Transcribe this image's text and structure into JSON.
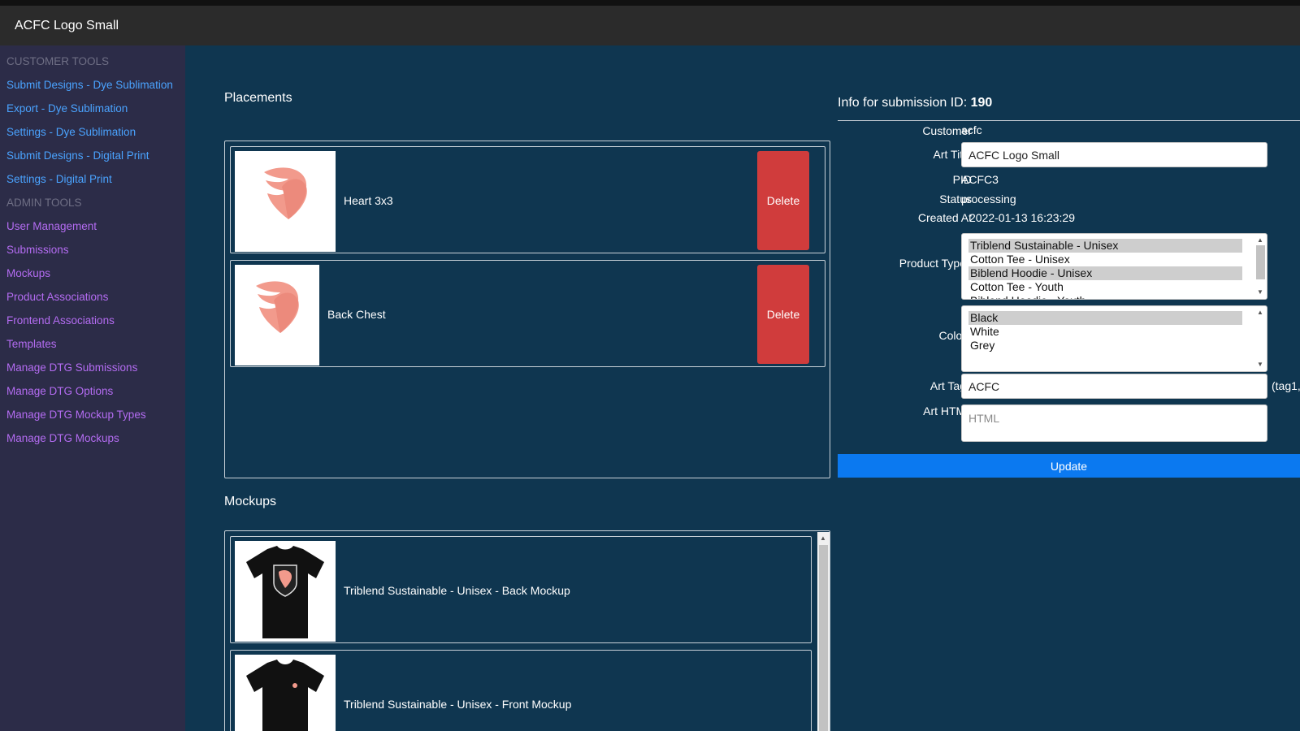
{
  "header": {
    "title": "ACFC Logo Small"
  },
  "colors": {
    "link": "#4aa3ff",
    "admin_link": "#b46cf2",
    "delete": "#d03c3c",
    "primary": "#0b79f0",
    "background": "#0f3650"
  },
  "sidebar": {
    "customer_heading": "CUSTOMER TOOLS",
    "customer_items": [
      {
        "label": "Submit Designs - Dye Sublimation"
      },
      {
        "label": "Export - Dye Sublimation"
      },
      {
        "label": "Settings - Dye Sublimation"
      },
      {
        "label": "Submit Designs - Digital Print"
      },
      {
        "label": "Settings - Digital Print"
      }
    ],
    "admin_heading": "ADMIN TOOLS",
    "admin_items": [
      {
        "label": "User Management"
      },
      {
        "label": "Submissions"
      },
      {
        "label": "Mockups"
      },
      {
        "label": "Product Associations"
      },
      {
        "label": "Frontend Associations"
      },
      {
        "label": "Templates"
      },
      {
        "label": "Manage DTG Submissions"
      },
      {
        "label": "Manage DTG Options"
      },
      {
        "label": "Manage DTG Mockup Types"
      },
      {
        "label": "Manage DTG Mockups"
      }
    ]
  },
  "placements": {
    "heading": "Placements",
    "items": [
      {
        "label": "Heart 3x3",
        "delete_label": "Delete"
      },
      {
        "label": "Back Chest",
        "delete_label": "Delete"
      }
    ]
  },
  "mockups": {
    "heading": "Mockups",
    "items": [
      {
        "label": "Triblend Sustainable - Unisex - Back Mockup"
      },
      {
        "label": "Triblend Sustainable - Unisex - Front Mockup"
      }
    ]
  },
  "info": {
    "title_prefix": "Info for submission ID:",
    "submission_id": "190",
    "customer_label": "Customer",
    "customer": "acfc",
    "art_title_label": "Art Title",
    "art_title": "ACFC Logo Small",
    "pid_label": "PID",
    "pid": "ACFC3",
    "status_label": "Status",
    "status": "processing",
    "created_label": "Created At",
    "created": "2022-01-13 16:23:29",
    "product_types_label": "Product Types",
    "product_types": [
      {
        "label": "Triblend Sustainable - Unisex",
        "selected": true
      },
      {
        "label": "Cotton Tee - Unisex",
        "selected": false
      },
      {
        "label": "Biblend Hoodie - Unisex",
        "selected": true
      },
      {
        "label": "Cotton Tee - Youth",
        "selected": false
      },
      {
        "label": "Biblend Hoodie - Youth",
        "selected": false
      }
    ],
    "colors_label": "Colors",
    "colors": [
      {
        "label": "Black",
        "selected": true
      },
      {
        "label": "White",
        "selected": false
      },
      {
        "label": "Grey",
        "selected": false
      }
    ],
    "art_tags_label": "Art Tags",
    "art_tags": "ACFC",
    "art_tags_hint": "(tag1,",
    "art_html_label": "Art HTML",
    "art_html_placeholder": "HTML",
    "update_label": "Update"
  }
}
